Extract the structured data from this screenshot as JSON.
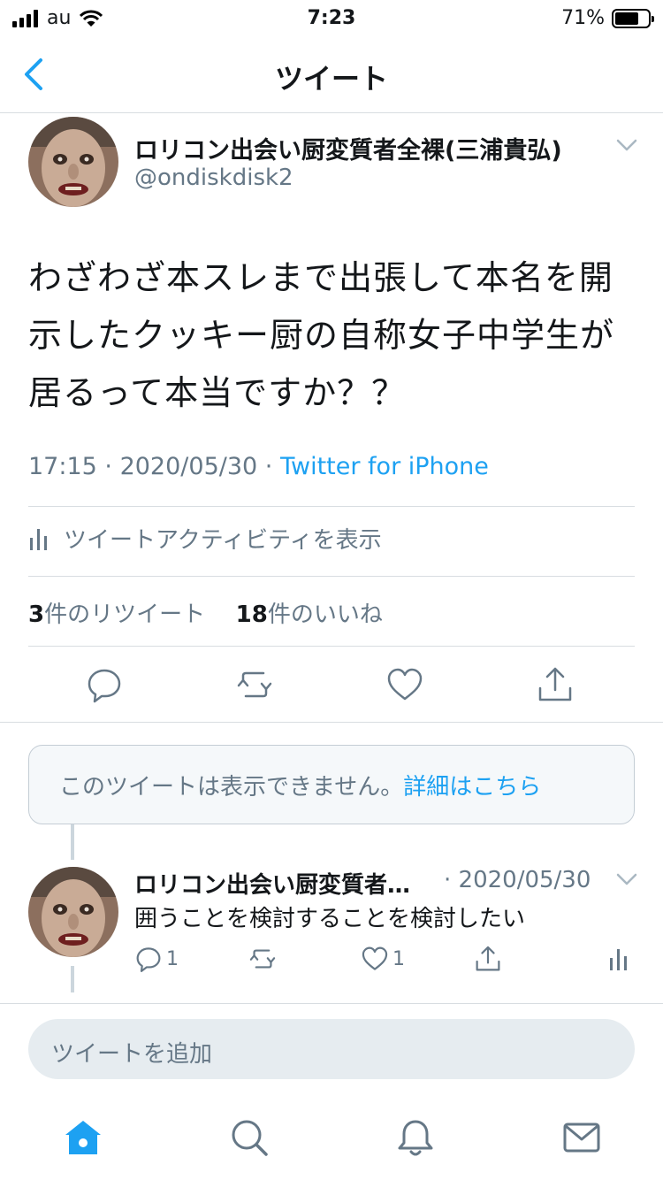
{
  "status_bar": {
    "carrier": "au",
    "time": "7:23",
    "battery_percent": "71%",
    "battery_level": 0.71
  },
  "nav": {
    "title": "ツイート"
  },
  "tweet": {
    "author_name": "ロリコン出会い厨変質者全裸(三浦貴弘)",
    "author_handle": "@ondiskdisk2",
    "text": "わざわざ本スレまで出張して本名を開示したクッキー厨の自称女子中学生が居るって本当ですか？？",
    "time": "17:15",
    "date": "2020/05/30",
    "client": "Twitter for iPhone",
    "activity_label": "ツイートアクティビティを表示",
    "retweet_count": "3",
    "retweet_label": "件のリツイート",
    "like_count": "18",
    "like_label": "件のいいね"
  },
  "unavailable": {
    "message": "このツイートは表示できません。",
    "link": "詳細はこちら"
  },
  "reply": {
    "author_name": "ロリコン出会い厨変質者…",
    "date": "· 2020/05/30",
    "text": "囲うことを検討することを検討したい",
    "reply_count": "1",
    "like_count": "1"
  },
  "compose": {
    "placeholder": "ツイートを追加"
  },
  "tabs": [
    "home-icon",
    "search-icon",
    "notifications-icon",
    "messages-icon"
  ],
  "colors": {
    "accent": "#1da1f2",
    "secondary_text": "#657786",
    "divider": "#d8dde1"
  }
}
